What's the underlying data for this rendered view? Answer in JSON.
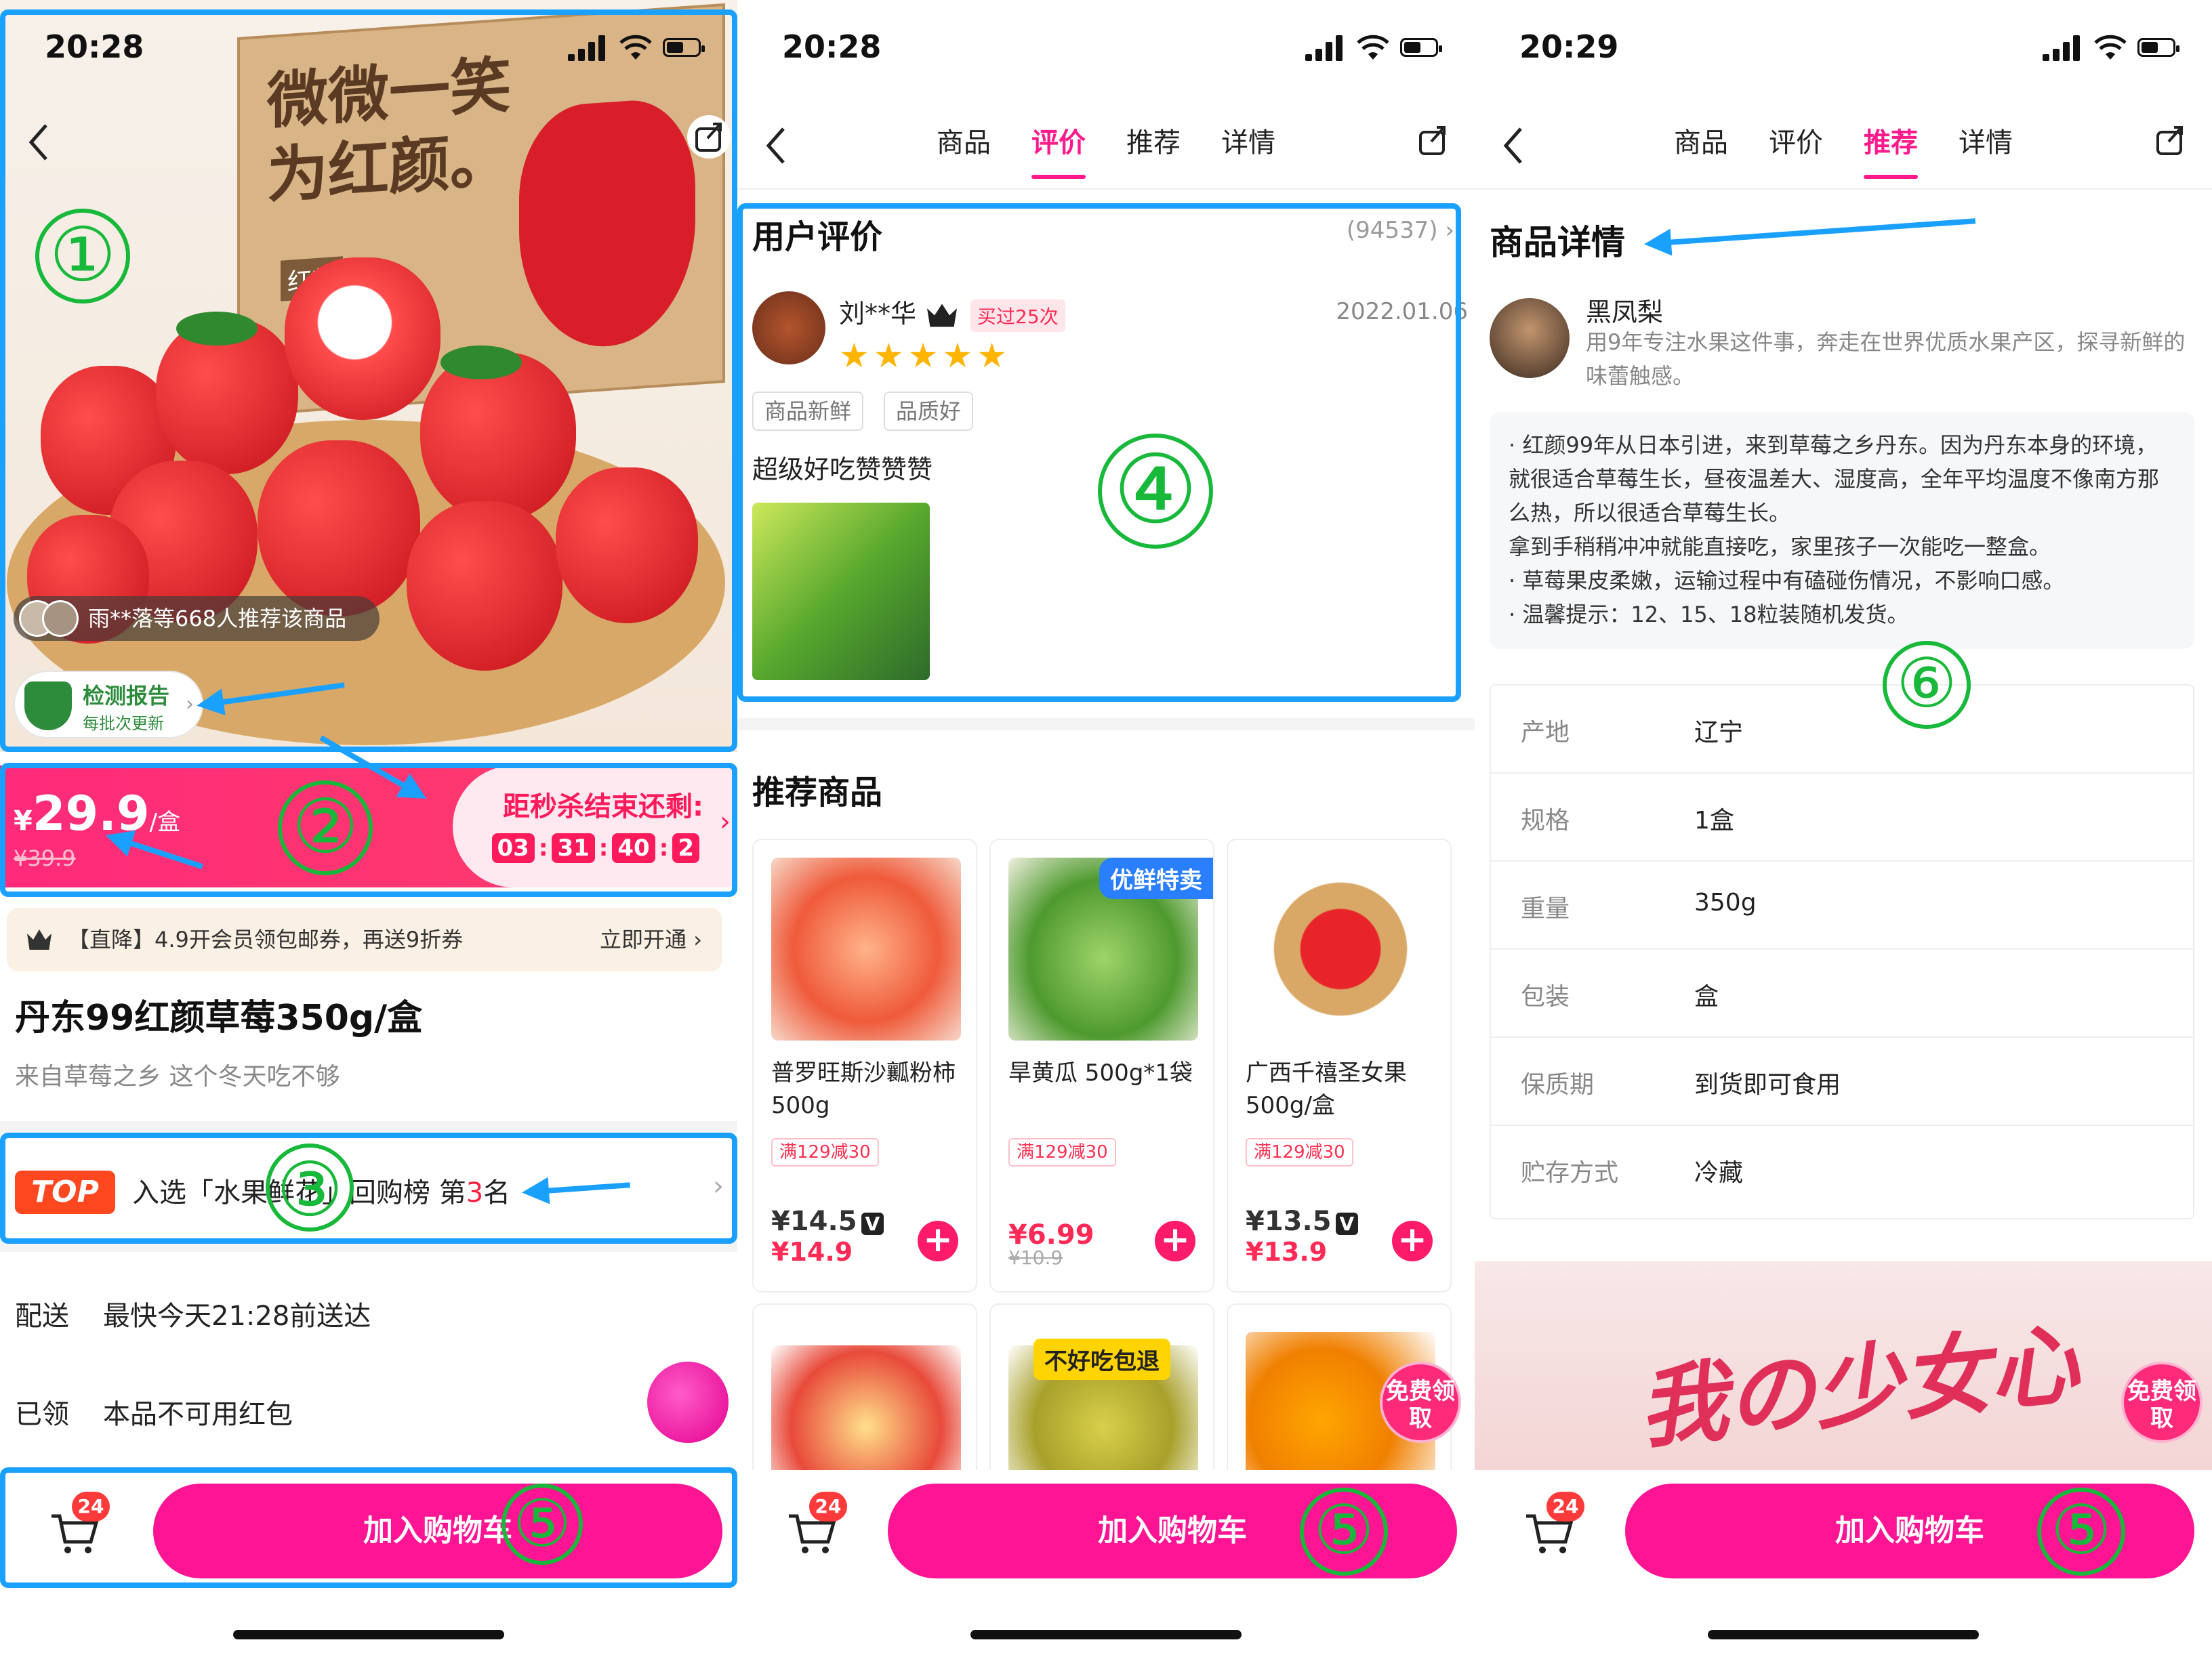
{
  "status": {
    "time1": "20:28",
    "time2": "20:28",
    "time3": "20:29"
  },
  "panel1": {
    "box_text_line1": "微微一笑",
    "box_text_line2": "为红颜。",
    "box_tag": "红颜",
    "recommend": "雨**落等668人推荐该商品",
    "test_title": "检测报告",
    "test_sub": "每批次更新",
    "price_symbol": "¥",
    "price": "29.9",
    "price_unit": "/盒",
    "old_price": "¥39.9",
    "countdown_title": "距秒杀结束还剩:",
    "countdown": [
      "03",
      "31",
      "40",
      "2"
    ],
    "vip_text": "【直降】4.9开会员领包邮券，再送9折券",
    "vip_open": "立即开通 ›",
    "title": "丹东99红颜草莓350g/盒",
    "subtitle": "来自草莓之乡 这个冬天吃不够",
    "rank_badge": "TOP",
    "rank_text_a": "入选「水果鲜花」回购榜 第",
    "rank_num": "3",
    "rank_text_b": "名",
    "delivery_label": "配送",
    "delivery_value": "最快今天21:28前送达",
    "coupon_label": "已领",
    "coupon_value": "本品不可用红包"
  },
  "panel2": {
    "tabs": [
      "商品",
      "评价",
      "推荐",
      "详情"
    ],
    "active_tab": "评价",
    "review_head": "用户评价",
    "review_count": "(94537) ›",
    "reviewer": "刘**华",
    "bought": "买过25次",
    "date": "2022.01.06",
    "stars": "★★★★★",
    "tags": [
      "商品新鲜",
      "品质好"
    ],
    "review_text": "超级好吃赞赞赞",
    "rec_head": "推荐商品",
    "products": [
      {
        "name": "普罗旺斯沙瓤粉柿500g",
        "coupon": "满129减30",
        "price": "¥14.5",
        "vip": "V",
        "price2": "¥14.9"
      },
      {
        "name": "旱黄瓜 500g*1袋",
        "coupon": "满129减30",
        "price": "¥6.99",
        "old": "¥10.9",
        "flag": "优鲜特卖"
      },
      {
        "name": "广西千禧圣女果500g/盒",
        "coupon": "满129减30",
        "price": "¥13.5",
        "vip": "V",
        "price2": "¥13.9"
      }
    ],
    "row2_flag": "不好吃包退",
    "free_badge": "免费领取"
  },
  "panel3": {
    "tabs": [
      "商品",
      "评价",
      "推荐",
      "详情"
    ],
    "active_tab": "推荐",
    "detail_head": "商品详情",
    "seller": "黑凤梨",
    "seller_intro": "用9年专注水果这件事，奔走在世界优质水果产区，探寻新鲜的味蕾触感。",
    "desc": [
      "· 红颜99年从日本引进，来到草莓之乡丹东。因为丹东本身的环境，就很适合草莓生长，昼夜温差大、湿度高，全年平均温度不像南方那么热，所以很适合草莓生长。",
      "拿到手稍稍冲冲就能直接吃，家里孩子一次能吃一整盒。",
      "· 草莓果皮柔嫩，运输过程中有磕碰伤情况，不影响口感。",
      "· 温馨提示：12、15、18粒装随机发货。"
    ],
    "specs": [
      {
        "k": "产地",
        "v": "辽宁"
      },
      {
        "k": "规格",
        "v": "1盒"
      },
      {
        "k": "重量",
        "v": "350g"
      },
      {
        "k": "包装",
        "v": "盒"
      },
      {
        "k": "保质期",
        "v": "到货即可食用"
      },
      {
        "k": "贮存方式",
        "v": "冷藏"
      }
    ],
    "banner_text": "我の少女心",
    "free_badge": "免费领取"
  },
  "bottom": {
    "cart_count": "24",
    "add_cart": "加入购物车"
  },
  "annotations": [
    "①",
    "②",
    "③",
    "④",
    "⑤",
    "⑥"
  ],
  "colors": {
    "accent": "#ff1493",
    "highlight": "#1aa0ff",
    "marker": "#18b83a"
  }
}
